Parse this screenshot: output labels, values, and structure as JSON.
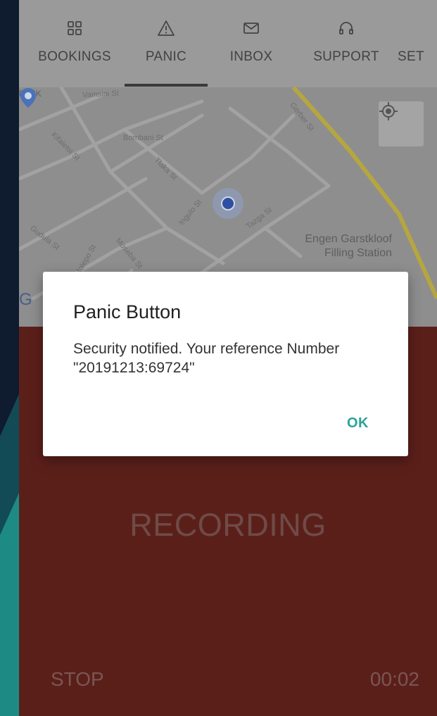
{
  "tabs": [
    {
      "label": "BOOKINGS",
      "icon": "grid-icon",
      "active": false
    },
    {
      "label": "PANIC",
      "icon": "warning-triangle-icon",
      "active": true
    },
    {
      "label": "INBOX",
      "icon": "mail-icon",
      "active": false
    },
    {
      "label": "SUPPORT",
      "icon": "headphones-icon",
      "active": false
    },
    {
      "label": "SET",
      "icon": "settings-icon",
      "active": false
    }
  ],
  "map": {
    "streets": [
      "PARK",
      "Vamsini St",
      "Bombani St",
      "Kifaletsi St",
      "Tlaka St",
      "Ingulo St",
      "Tazga St",
      "Gudula St",
      "Moseba St",
      "Molepo St",
      "Gerber St"
    ],
    "poi_label": "Engen Garstkloof Filling Station",
    "logo_fragment": "G"
  },
  "recording": {
    "status_text": "RECORDING",
    "stop_label": "STOP",
    "elapsed": "00:02"
  },
  "dialog": {
    "title": "Panic Button",
    "message": "Security notified. Your reference Number \"20191213:69724\"",
    "ok_label": "OK"
  },
  "colors": {
    "accent": "#2aa39a",
    "recording_background": "#5b1f1a",
    "tab_bar": "#9a9a9a"
  }
}
